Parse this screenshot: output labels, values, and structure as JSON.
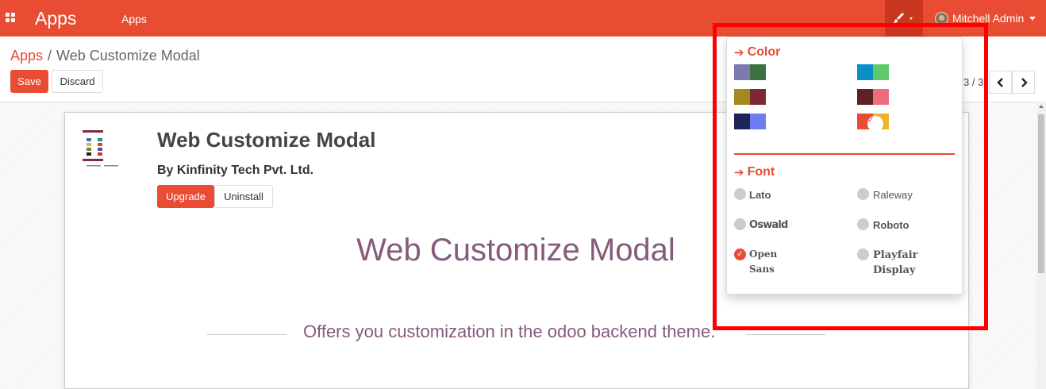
{
  "navbar": {
    "app_name": "Apps",
    "menu_item": "Apps",
    "user_name": "Mitchell Admin",
    "brand_color": "#e84c32",
    "icons": {
      "apps_menu": "grid-icon",
      "theme": "paintbrush-icon",
      "user": "avatar"
    }
  },
  "breadcrumb": {
    "parent": "Apps",
    "separator": "/",
    "current": "Web Customize Modal"
  },
  "actions": {
    "save": "Save",
    "discard": "Discard"
  },
  "pager": {
    "value": "3 / 3"
  },
  "app": {
    "title": "Web Customize Modal",
    "author": "By Kinfinity Tech Pvt. Ltd.",
    "upgrade": "Upgrade",
    "uninstall": "Uninstall"
  },
  "description": {
    "title": "Web Customize Modal",
    "subtitle": "Offers you customization in the odoo backend theme."
  },
  "customizer": {
    "color_heading": "Color",
    "font_heading": "Font",
    "swatches": [
      {
        "colors": [
          "#7c7bad",
          "#3b7240"
        ],
        "selected": false
      },
      {
        "colors": [
          "#0990c6",
          "#5dc96b"
        ],
        "selected": false
      },
      {
        "colors": [
          "#a28a1e",
          "#7c2a32"
        ],
        "selected": false
      },
      {
        "colors": [
          "#5b2325",
          "#ec6e7b"
        ],
        "selected": false
      },
      {
        "colors": [
          "#1d2459",
          "#6d7cf0"
        ],
        "selected": false
      },
      {
        "colors": [
          "#e84c32",
          "#f4b22a"
        ],
        "selected": true
      }
    ],
    "fonts": [
      {
        "name": "Lato",
        "selected": false
      },
      {
        "name": "Raleway",
        "selected": false
      },
      {
        "name": "Oswald",
        "selected": false
      },
      {
        "name": "Roboto",
        "selected": false
      },
      {
        "name": "Open Sans",
        "selected": true
      },
      {
        "name": "Playfair Display",
        "selected": false
      }
    ]
  }
}
